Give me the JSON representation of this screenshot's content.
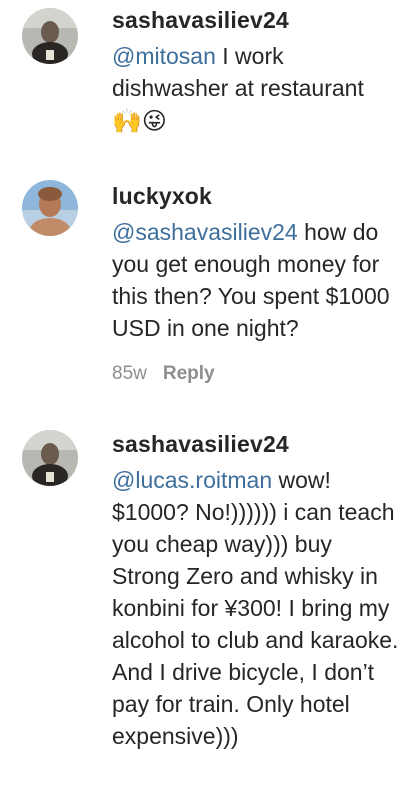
{
  "comments": [
    {
      "username": "sashavasiliev24",
      "mention": "@mitosan",
      "text": " I work dishwasher at restaurant",
      "emoji": "🙌😜"
    },
    {
      "username": "luckyxok",
      "mention": "@sashavasiliev24",
      "text": " how do you get enough money for this then? You spent $1000 USD in one night?",
      "time": "85w",
      "reply_label": "Reply"
    },
    {
      "username": "sashavasiliev24",
      "mention": "@lucas.roitman",
      "text": " wow! $1000? No!)))))) i can teach you cheap way))) buy Strong Zero and whisky in konbini for ¥300! I bring my alcohol to club and karaoke. And I drive bicycle, I don’t pay for train. Only hotel expensive)))"
    }
  ]
}
